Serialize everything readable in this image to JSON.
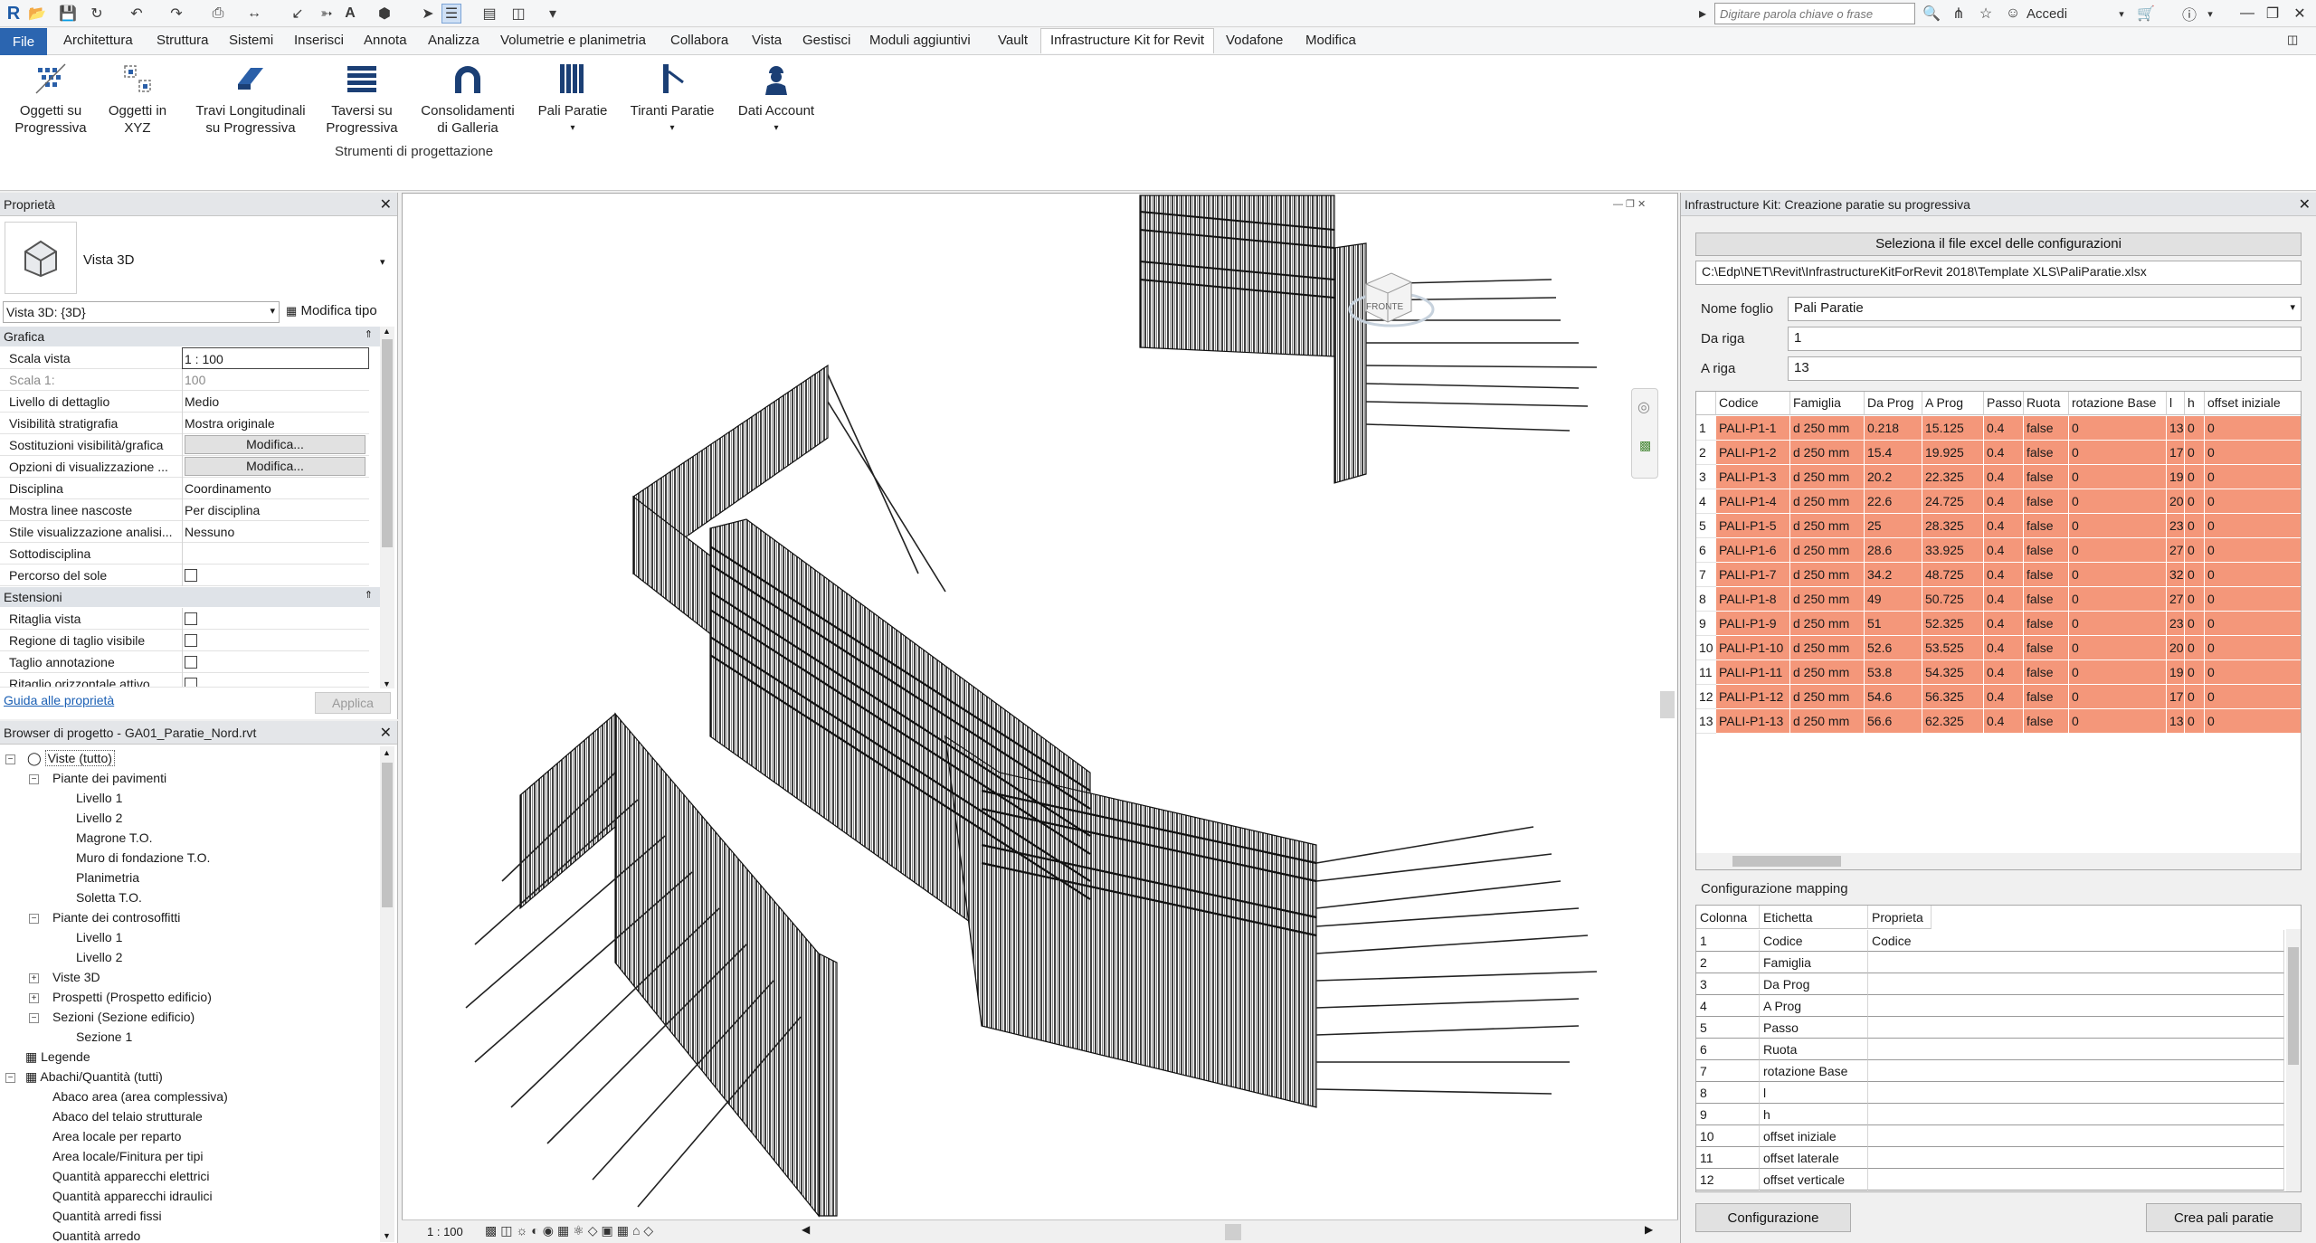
{
  "titlebar": {
    "search_placeholder": "Digitare parola chiave o frase",
    "signin": "Accedi"
  },
  "menu": {
    "file": "File",
    "items": [
      "Architettura",
      "Struttura",
      "Sistemi",
      "Inserisci",
      "Annota",
      "Analizza",
      "Volumetrie e planimetria",
      "Collabora",
      "Vista",
      "Gestisci",
      "Moduli aggiuntivi",
      "Vault",
      "Infrastructure Kit for Revit",
      "Vodafone",
      "Modifica"
    ],
    "active": "Infrastructure Kit for Revit"
  },
  "ribbon": {
    "buttons": [
      {
        "line1": "Oggetti su",
        "line2": "Progressiva"
      },
      {
        "line1": "Oggetti in",
        "line2": "XYZ"
      },
      {
        "line1": "Travi Longitudinali",
        "line2": "su Progressiva"
      },
      {
        "line1": "Taversi su",
        "line2": "Progressiva"
      },
      {
        "line1": "Consolidamenti",
        "line2": "di Galleria"
      },
      {
        "line1": "Pali Paratie",
        "line2": ""
      },
      {
        "line1": "Tiranti Paratie",
        "line2": ""
      },
      {
        "line1": "Dati Account",
        "line2": ""
      }
    ],
    "group_label": "Strumenti di progettazione"
  },
  "properties": {
    "title": "Proprietà",
    "type_name": "Vista 3D",
    "selector": "Vista 3D: {3D}",
    "edit_type": "Modifica tipo",
    "section_grafica": "Grafica",
    "section_estensioni": "Estensioni",
    "rows": [
      {
        "label": "Scala vista",
        "value": "1 : 100"
      },
      {
        "label": "Scala  1:",
        "value": "100"
      },
      {
        "label": "Livello di dettaglio",
        "value": "Medio"
      },
      {
        "label": "Visibilità stratigrafia",
        "value": "Mostra originale"
      },
      {
        "label": "Sostituzioni visibilità/grafica",
        "value": "Modifica..."
      },
      {
        "label": "Opzioni di visualizzazione ...",
        "value": "Modifica..."
      },
      {
        "label": "Disciplina",
        "value": "Coordinamento"
      },
      {
        "label": "Mostra linee nascoste",
        "value": "Per disciplina"
      },
      {
        "label": "Stile visualizzazione analisi...",
        "value": "Nessuno"
      },
      {
        "label": "Sottodisciplina",
        "value": ""
      },
      {
        "label": "Percorso del sole",
        "value": ""
      }
    ],
    "ext_rows": [
      {
        "label": "Ritaglia vista"
      },
      {
        "label": "Regione di taglio visibile"
      },
      {
        "label": "Taglio annotazione"
      },
      {
        "label": "Ritaglio orizzontale attivo"
      }
    ],
    "help_link": "Guida alle proprietà",
    "apply": "Applica"
  },
  "browser": {
    "title": "Browser di progetto - GA01_Paratie_Nord.rvt",
    "items": [
      "Viste (tutto)",
      "Piante dei pavimenti",
      "Livello 1",
      "Livello 2",
      "Magrone T.O.",
      "Muro di fondazione T.O.",
      "Planimetria",
      "Soletta T.O.",
      "Piante dei controsoffitti",
      "Livello 1",
      "Livello 2",
      "Viste 3D",
      "Prospetti (Prospetto edificio)",
      "Sezioni (Sezione edificio)",
      "Sezione 1",
      "Legende",
      "Abachi/Quantità (tutti)",
      "Abaco area (area complessiva)",
      "Abaco del telaio strutturale",
      "Area locale per reparto",
      "Area locale/Finitura per tipi",
      "Quantità apparecchi elettrici",
      "Quantità apparecchi idraulici",
      "Quantità arredi fissi",
      "Quantità arredo"
    ]
  },
  "view": {
    "scale": "1 : 100",
    "viewcube_face": "FRONTE"
  },
  "plugin": {
    "title": "Infrastructure Kit: Creazione paratie su progressiva",
    "select_excel": "Seleziona il file excel delle configurazioni",
    "file_path": "C:\\Edp\\NET\\Revit\\InfrastructureKitForRevit 2018\\Template XLS\\PaliParatie.xlsx",
    "sheet_label": "Nome foglio",
    "sheet_value": "Pali Paratie",
    "from_label": "Da riga",
    "from_value": "1",
    "to_label": "A riga",
    "to_value": "13",
    "columns": [
      "Codice",
      "Famiglia",
      "Da Prog",
      "A Prog",
      "Passo",
      "Ruota",
      "rotazione Base",
      "l",
      "h",
      "offset iniziale"
    ],
    "rows": [
      [
        "PALI-P1-1",
        "d 250 mm",
        "0.218",
        "15.125",
        "0.4",
        "false",
        "0",
        "13",
        "0",
        "0"
      ],
      [
        "PALI-P1-2",
        "d 250 mm",
        "15.4",
        "19.925",
        "0.4",
        "false",
        "0",
        "17",
        "0",
        "0"
      ],
      [
        "PALI-P1-3",
        "d 250 mm",
        "20.2",
        "22.325",
        "0.4",
        "false",
        "0",
        "19",
        "0",
        "0"
      ],
      [
        "PALI-P1-4",
        "d 250 mm",
        "22.6",
        "24.725",
        "0.4",
        "false",
        "0",
        "20",
        "0",
        "0"
      ],
      [
        "PALI-P1-5",
        "d 250 mm",
        "25",
        "28.325",
        "0.4",
        "false",
        "0",
        "23",
        "0",
        "0"
      ],
      [
        "PALI-P1-6",
        "d 250 mm",
        "28.6",
        "33.925",
        "0.4",
        "false",
        "0",
        "27",
        "0",
        "0"
      ],
      [
        "PALI-P1-7",
        "d 250 mm",
        "34.2",
        "48.725",
        "0.4",
        "false",
        "0",
        "32",
        "0",
        "0"
      ],
      [
        "PALI-P1-8",
        "d 250 mm",
        "49",
        "50.725",
        "0.4",
        "false",
        "0",
        "27",
        "0",
        "0"
      ],
      [
        "PALI-P1-9",
        "d 250 mm",
        "51",
        "52.325",
        "0.4",
        "false",
        "0",
        "23",
        "0",
        "0"
      ],
      [
        "PALI-P1-10",
        "d 250 mm",
        "52.6",
        "53.525",
        "0.4",
        "false",
        "0",
        "20",
        "0",
        "0"
      ],
      [
        "PALI-P1-11",
        "d 250 mm",
        "53.8",
        "54.325",
        "0.4",
        "false",
        "0",
        "19",
        "0",
        "0"
      ],
      [
        "PALI-P1-12",
        "d 250 mm",
        "54.6",
        "56.325",
        "0.4",
        "false",
        "0",
        "17",
        "0",
        "0"
      ],
      [
        "PALI-P1-13",
        "d 250 mm",
        "56.6",
        "62.325",
        "0.4",
        "false",
        "0",
        "13",
        "0",
        "0"
      ]
    ],
    "mapping_label": "Configurazione mapping",
    "mapping_columns": [
      "Colonna",
      "Etichetta",
      "Proprieta"
    ],
    "mapping_rows": [
      [
        "1",
        "Codice",
        "Codice"
      ],
      [
        "2",
        "Famiglia",
        ""
      ],
      [
        "3",
        "Da Prog",
        ""
      ],
      [
        "4",
        "A Prog",
        ""
      ],
      [
        "5",
        "Passo",
        ""
      ],
      [
        "6",
        "Ruota",
        ""
      ],
      [
        "7",
        "rotazione Base",
        ""
      ],
      [
        "8",
        "l",
        ""
      ],
      [
        "9",
        "h",
        ""
      ],
      [
        "10",
        "offset iniziale",
        ""
      ],
      [
        "11",
        "offset laterale",
        ""
      ],
      [
        "12",
        "offset verticale",
        ""
      ]
    ],
    "config_button": "Configurazione",
    "create_button": "Crea pali paratie"
  },
  "colors": {
    "accent": "#2b65b0",
    "row_highlight": "#f4977a"
  }
}
